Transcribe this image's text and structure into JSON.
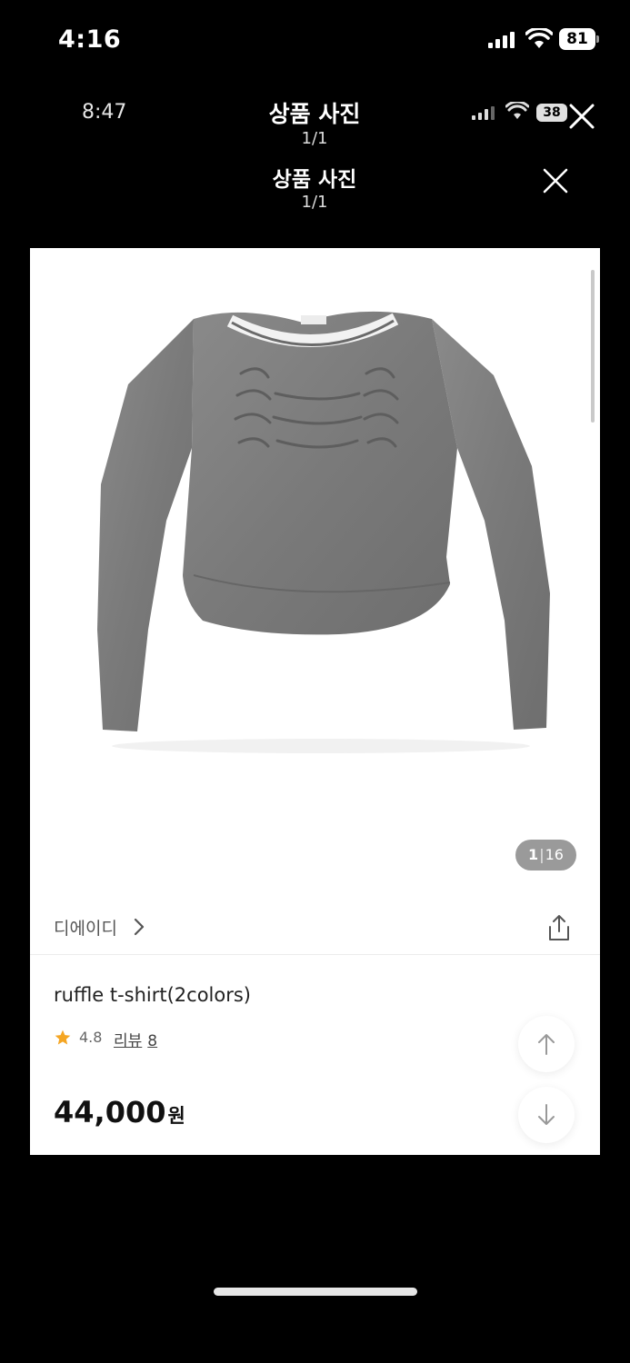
{
  "device_status": {
    "time": "4:16",
    "battery": "81",
    "icons": [
      "cellular-signal-icon",
      "wifi-icon",
      "battery-icon"
    ]
  },
  "inner_status": {
    "time": "8:47",
    "battery": "38",
    "title": "상품 사진",
    "page": "1/1",
    "icons": [
      "cellular-signal-icon",
      "wifi-icon",
      "battery-icon",
      "close-icon"
    ]
  },
  "viewer": {
    "title": "상품 사진",
    "page": "1/1",
    "close_icon": "close-icon"
  },
  "product": {
    "image_alt": "Gray ruffle long-sleeve t-shirt",
    "counter_current": "1",
    "counter_separator": "|",
    "counter_total": "16",
    "brand": "디에이디",
    "name": "ruffle t-shirt(2colors)",
    "rating": "4.8",
    "review_label": "리뷰",
    "review_count": "8",
    "price": "44,000",
    "currency": "원",
    "icons": [
      "chevron-right-icon",
      "share-icon",
      "star-icon",
      "arrow-up-icon",
      "arrow-down-icon"
    ]
  },
  "colors": {
    "background": "#000000",
    "card": "#ffffff",
    "star": "#f5a623",
    "counter_pill": "#9a9a9a"
  }
}
